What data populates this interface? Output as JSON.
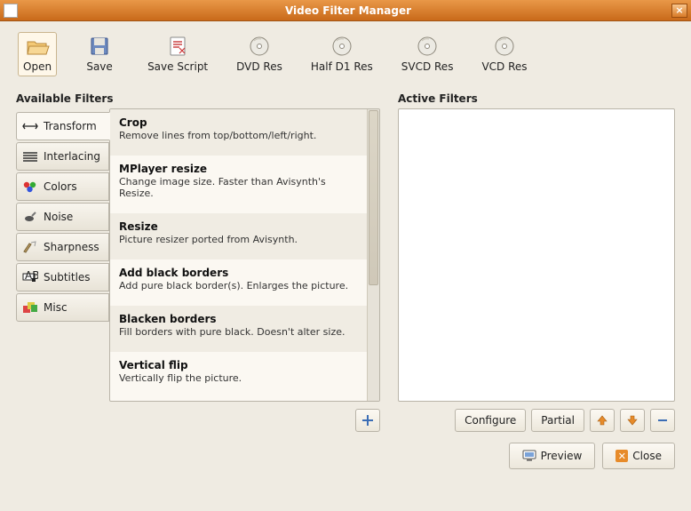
{
  "window": {
    "title": "Video Filter Manager"
  },
  "toolbar": [
    {
      "label": "Open",
      "icon": "open"
    },
    {
      "label": "Save",
      "icon": "save"
    },
    {
      "label": "Save Script",
      "icon": "script"
    },
    {
      "label": "DVD Res",
      "icon": "disc"
    },
    {
      "label": "Half D1 Res",
      "icon": "disc"
    },
    {
      "label": "SVCD Res",
      "icon": "disc"
    },
    {
      "label": "VCD Res",
      "icon": "disc"
    }
  ],
  "sections": {
    "available": "Available Filters",
    "active": "Active Filters"
  },
  "tabs": [
    {
      "label": "Transform"
    },
    {
      "label": "Interlacing"
    },
    {
      "label": "Colors"
    },
    {
      "label": "Noise"
    },
    {
      "label": "Sharpness"
    },
    {
      "label": "Subtitles"
    },
    {
      "label": "Misc"
    }
  ],
  "filters": [
    {
      "name": "Crop",
      "desc": "Remove lines from top/bottom/left/right."
    },
    {
      "name": "MPlayer resize",
      "desc": "Change image size. Faster than Avisynth's Resize."
    },
    {
      "name": "Resize",
      "desc": "Picture resizer ported from Avisynth."
    },
    {
      "name": "Add black borders",
      "desc": "Add pure black border(s). Enlarges the picture."
    },
    {
      "name": "Blacken borders",
      "desc": "Fill borders with pure black. Doesn't alter size."
    },
    {
      "name": "Vertical flip",
      "desc": "Vertically flip the picture."
    }
  ],
  "buttons": {
    "configure": "Configure",
    "partial": "Partial",
    "preview": "Preview",
    "close": "Close"
  }
}
